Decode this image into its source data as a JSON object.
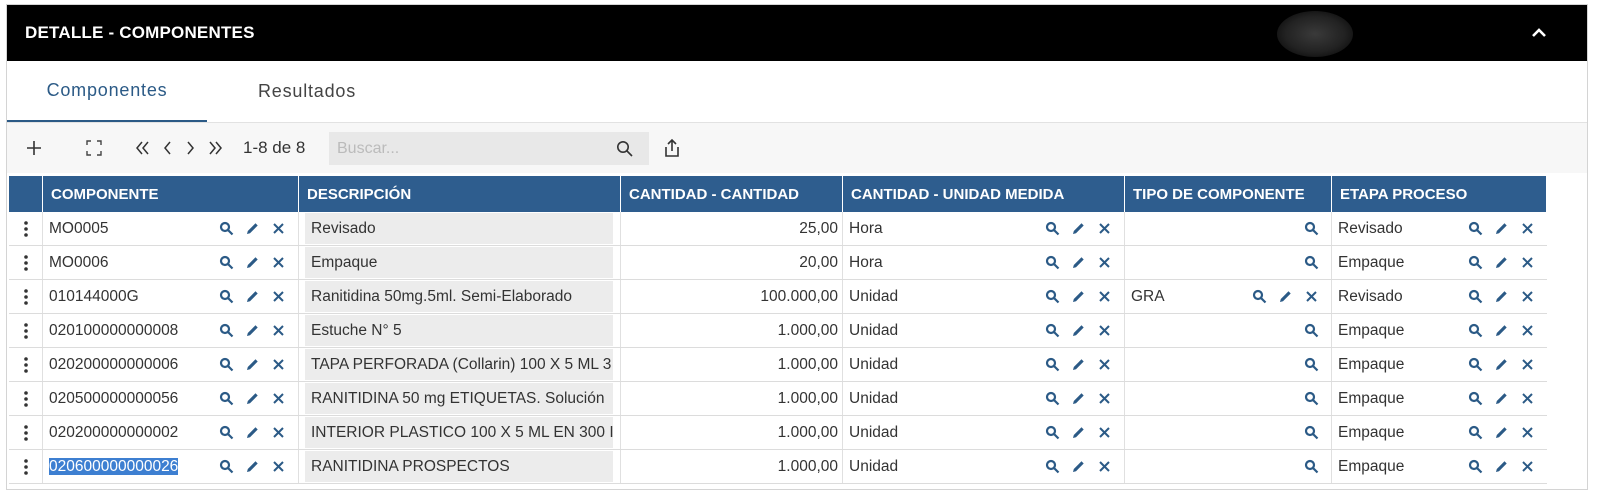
{
  "panel": {
    "title": "DETALLE - COMPONENTES"
  },
  "tabs": [
    {
      "label": "Componentes"
    },
    {
      "label": "Resultados"
    }
  ],
  "toolbar": {
    "page_info": "1-8 de 8",
    "search_placeholder": "Buscar..."
  },
  "columns": [
    "COMPONENTE",
    "DESCRIPCIÓN",
    "CANTIDAD - CANTIDAD",
    "CANTIDAD - UNIDAD MEDIDA",
    "TIPO DE COMPONENTE",
    "ETAPA PROCESO"
  ],
  "rows": [
    {
      "componente": "MO0005",
      "descripcion": "Revisado",
      "cantidad": "25,00",
      "unidad": "Hora",
      "tipo": "",
      "etapa": "Revisado"
    },
    {
      "componente": "MO0006",
      "descripcion": "Empaque",
      "cantidad": "20,00",
      "unidad": "Hora",
      "tipo": "",
      "etapa": "Empaque"
    },
    {
      "componente": "010144000G",
      "descripcion": "Ranitidina 50mg.5ml.  Semi-Elaborado",
      "cantidad": "100.000,00",
      "unidad": "Unidad",
      "tipo": "GRA",
      "etapa": "Revisado"
    },
    {
      "componente": "020100000000008",
      "descripcion": "Estuche N° 5",
      "cantidad": "1.000,00",
      "unidad": "Unidad",
      "tipo": "",
      "etapa": "Empaque"
    },
    {
      "componente": "020200000000006",
      "descripcion": "TAPA PERFORADA (Collarin) 100 X 5 ML 3",
      "cantidad": "1.000,00",
      "unidad": "Unidad",
      "tipo": "",
      "etapa": "Empaque"
    },
    {
      "componente": "020500000000056",
      "descripcion": "RANITIDINA 50 mg ETIQUETAS.  Solución",
      "cantidad": "1.000,00",
      "unidad": "Unidad",
      "tipo": "",
      "etapa": "Empaque"
    },
    {
      "componente": "020200000000002",
      "descripcion": "INTERIOR PLASTICO 100 X 5 ML EN 300 I",
      "cantidad": "1.000,00",
      "unidad": "Unidad",
      "tipo": "",
      "etapa": "Empaque"
    },
    {
      "componente": "020600000000026",
      "descripcion": "RANITIDINA  PROSPECTOS",
      "cantidad": "1.000,00",
      "unidad": "Unidad",
      "tipo": "",
      "etapa": "Empaque",
      "selected": true
    }
  ],
  "colors": {
    "header_bg": "#2e5d8e",
    "title_bg": "#000000",
    "active_tab": "#2b5a86",
    "icon_blue": "#2b5a86",
    "selection": "#3d7fd1"
  }
}
